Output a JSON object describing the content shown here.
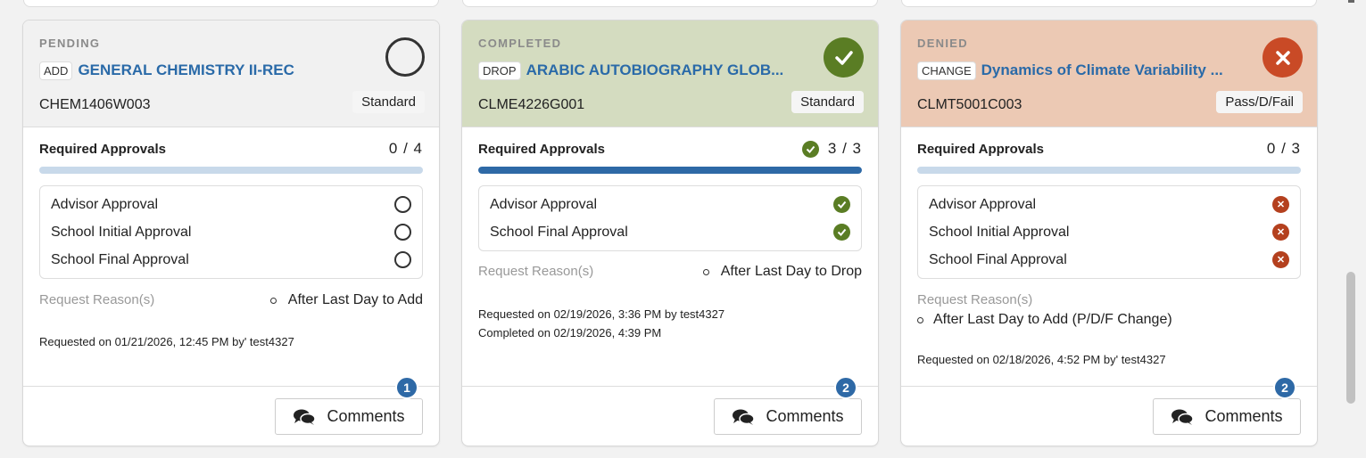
{
  "cards": [
    {
      "status": "PENDING",
      "type": "ADD",
      "title": "GENERAL CHEMISTRY II-REC",
      "code": "CHEM1406W003",
      "grade": "Standard",
      "status_icon": "empty-circle-icon",
      "header_color": "#f1f1f1",
      "approvals_label": "Required Approvals",
      "approvals_count": "0 / 4",
      "progress": 0,
      "approvals": [
        {
          "label": "Advisor Approval",
          "state": "pending"
        },
        {
          "label": "School Initial Approval",
          "state": "pending"
        },
        {
          "label": "School Final Approval",
          "state": "pending"
        }
      ],
      "reason_label": "Request Reason(s)",
      "reason": "After Last Day to Add",
      "requested": "Requested on 01/21/2026, 12:45 PM by' test4327",
      "completed": "",
      "comments_label": "Comments",
      "comments_count": "1"
    },
    {
      "status": "COMPLETED",
      "type": "DROP",
      "title": "ARABIC AUTOBIOGRAPHY GLOB...",
      "code": "CLME4226G001",
      "grade": "Standard",
      "status_icon": "check-icon",
      "header_color": "#d4dcc0",
      "approvals_label": "Required Approvals",
      "approvals_count": "3 / 3",
      "progress": 1,
      "approvals": [
        {
          "label": "Advisor Approval",
          "state": "approved"
        },
        {
          "label": "School Final Approval",
          "state": "approved"
        }
      ],
      "reason_label": "Request Reason(s)",
      "reason": "After Last Day to Drop",
      "requested": "Requested on 02/19/2026, 3:36 PM by test4327",
      "completed": "Completed on 02/19/2026, 4:39 PM",
      "comments_label": "Comments",
      "comments_count": "2"
    },
    {
      "status": "DENIED",
      "type": "CHANGE",
      "title": "Dynamics of Climate Variability ...",
      "code": "CLMT5001C003",
      "grade": "Pass/D/Fail",
      "status_icon": "x-icon",
      "header_color": "#ecc9b4",
      "approvals_label": "Required Approvals",
      "approvals_count": "0 / 3",
      "progress": 0,
      "approvals": [
        {
          "label": "Advisor Approval",
          "state": "denied"
        },
        {
          "label": "School Initial Approval",
          "state": "denied"
        },
        {
          "label": "School Final Approval",
          "state": "denied"
        }
      ],
      "reason_label": "Request Reason(s)",
      "reason": "After Last Day to Add (P/D/F Change)",
      "requested": "Requested on 02/18/2026, 4:52 PM by' test4327",
      "completed": "",
      "comments_label": "Comments",
      "comments_count": "2"
    }
  ],
  "colors": {
    "accent_blue": "#2e69a6",
    "approved_green": "#5a7d24",
    "denied_red": "#b4401e"
  }
}
